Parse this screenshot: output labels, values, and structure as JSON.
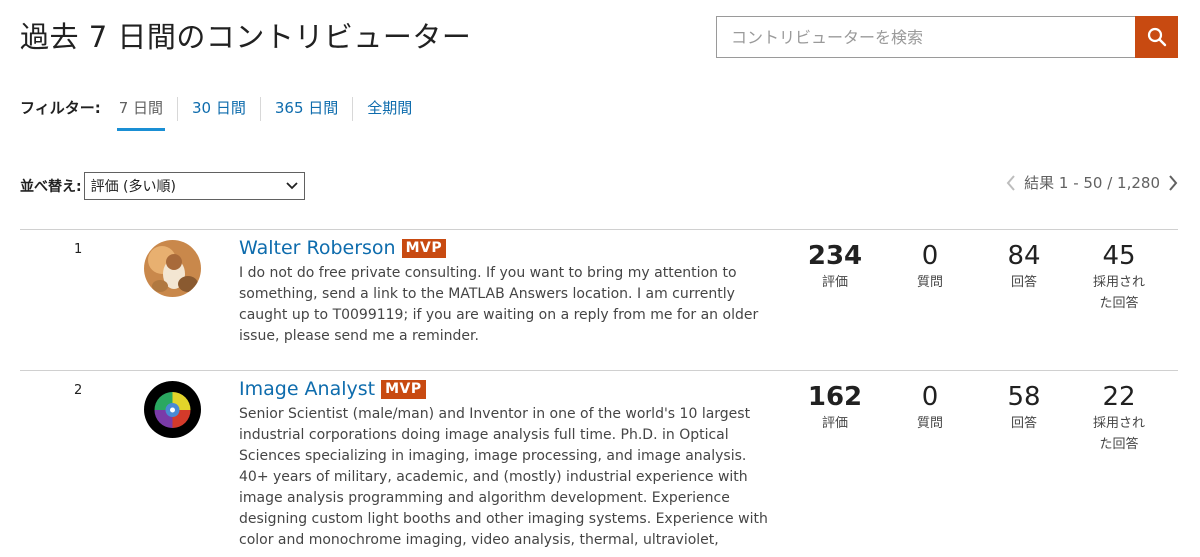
{
  "page": {
    "title": "過去 7 日間のコントリビューター"
  },
  "search": {
    "placeholder": "コントリビューターを検索",
    "icon": "search-icon",
    "button_color": "#c84a11"
  },
  "filter": {
    "label": "フィルター:",
    "tabs": [
      "7 日間",
      "30 日間",
      "365 日間",
      "全期間"
    ],
    "active_index": 0
  },
  "sort": {
    "label": "並べ替え:",
    "selected": "評価 (多い順)"
  },
  "pagination": {
    "text": "結果 1 - 50 / 1,280"
  },
  "contributors": [
    {
      "rank": "1",
      "name": "Walter Roberson",
      "badge": "MVP",
      "bio": "I do not do free private consulting. If you want to bring my attention to something, send a link to the MATLAB Answers location. I am currently caught up to T0099119; if you are waiting on a reply from me for an older issue, please send me a reminder.",
      "reputation": "234",
      "reputation_label": "評価",
      "questions": "0",
      "questions_label": "質問",
      "answers": "84",
      "answers_label": "回答",
      "accepted": "45",
      "accepted_label": "採用された回答"
    },
    {
      "rank": "2",
      "name": "Image Analyst",
      "badge": "MVP",
      "bio": "Senior Scientist (male/man) and Inventor in one of the world's 10 largest industrial corporations doing image analysis full time. Ph.D. in Optical Sciences specializing in imaging, image processing, and image analysis. 40+ years of military, academic, and (mostly) industrial experience with image analysis programming and algorithm development. Experience designing custom light booths and other imaging systems. Experience with color and monochrome imaging, video analysis, thermal, ultraviolet,",
      "reputation": "162",
      "reputation_label": "評価",
      "questions": "0",
      "questions_label": "質問",
      "answers": "58",
      "answers_label": "回答",
      "accepted": "22",
      "accepted_label": "採用された回答"
    }
  ],
  "colors": {
    "link": "#0e6cad",
    "accent": "#c84a11",
    "active_tab_underline": "#1a8fd4"
  }
}
